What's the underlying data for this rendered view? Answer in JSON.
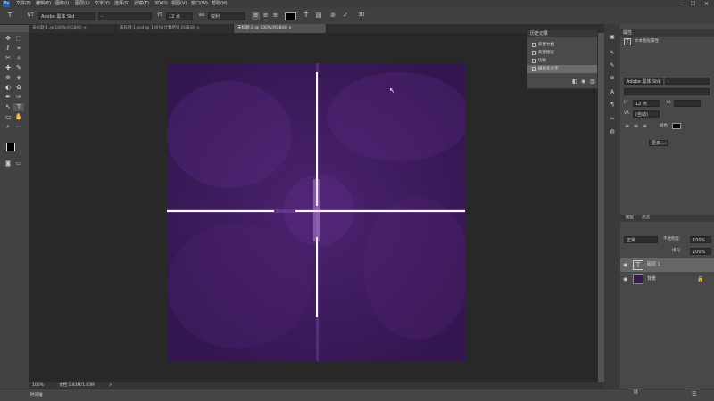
{
  "menubar": {
    "logo": "Ps",
    "items": [
      "文件(F)",
      "编辑(E)",
      "图像(I)",
      "图层(L)",
      "文字(Y)",
      "选择(S)",
      "滤镜(T)",
      "3D(D)",
      "视图(V)",
      "窗口(W)",
      "帮助(H)"
    ],
    "minimize": "—",
    "maximize": "☐",
    "close": "✕"
  },
  "options": {
    "tool_icon": "T",
    "orient_icon": "⇅T",
    "font_family": "Adobe 黑体 Std",
    "font_style": "-",
    "size_icon": "tT",
    "font_size": "12 点",
    "aa_icon": "aa",
    "aa_mode": "锐利",
    "align_left": "≡",
    "align_center": "≡",
    "align_right": "≡",
    "color_swatch": "#000000",
    "warp_icon": "T̃",
    "panel_icon": "▤",
    "cancel_icon": "⊘",
    "commit_icon": "✓",
    "3d_icon": "3D"
  },
  "tabs": [
    {
      "label": "未标题-1 @ 100%(RGB/8)",
      "close": "×"
    },
    {
      "label": "未标题-1.psd @ 100%(计算结果,RGB/8)",
      "close": "×"
    },
    {
      "label": "未标题-2 @ 100%(RGB/8)",
      "close": "×"
    }
  ],
  "tools": [
    "✥",
    "⬚",
    "ℓ",
    "⌖",
    "✂",
    "⌕",
    "✚",
    "✎",
    "⊕",
    "◈",
    "◐",
    "✿",
    "✒",
    "T",
    "↖",
    "▭",
    "✋",
    "⌕",
    "⋯"
  ],
  "canvas": {
    "bg": "#3a1a55"
  },
  "status": {
    "zoom": "100%",
    "doc": "文档:1.83M/1.83M",
    "arrow": ">"
  },
  "bottom": {
    "tab": "时间轴"
  },
  "history": {
    "title": "历史记录",
    "items": [
      "新建文档",
      "新建图层",
      "切换",
      "栅格化文字"
    ]
  },
  "character": {
    "title": "属性",
    "subtitle": "文本图层属性",
    "font_family": "Adobe 黑体 Std",
    "font_style": "-",
    "font_size": "12 点",
    "leading": "(自动)",
    "kerning": "0",
    "align_label": "颜色:",
    "more": "更多...",
    "color": "#000000"
  },
  "layers": {
    "tabs": [
      "图层",
      "通道"
    ],
    "blend": "正常",
    "opacity_label": "不透明度:",
    "opacity": "100%",
    "fill_label": "填充:",
    "fill": "100%",
    "items": [
      {
        "name": "图层 1",
        "type": "T"
      },
      {
        "name": "背景",
        "type": "bg"
      }
    ],
    "footer_icons": [
      "⛓",
      "fx",
      "◑",
      "▣",
      "▤",
      "🗑"
    ]
  }
}
